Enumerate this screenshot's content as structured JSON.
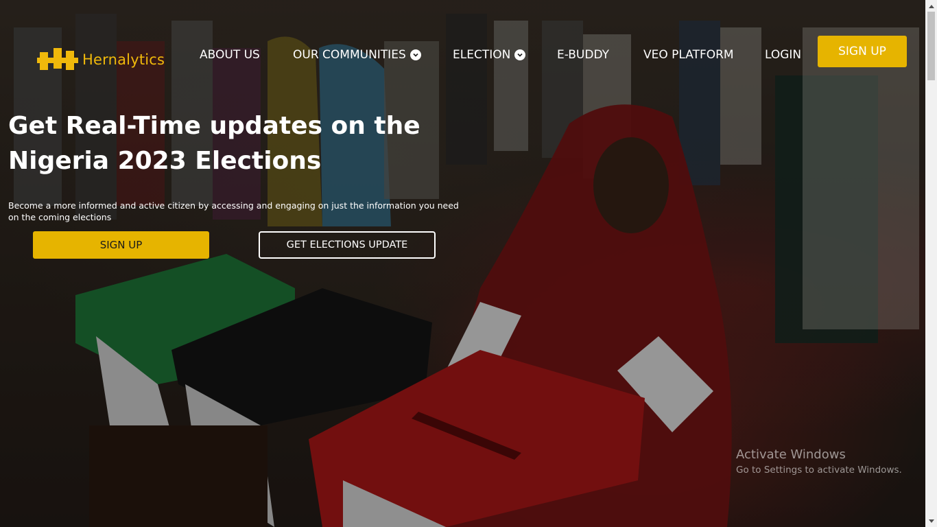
{
  "brand": {
    "name": "Hernalytics",
    "accent": "#e6b400"
  },
  "nav": {
    "items": [
      {
        "label": "ABOUT US",
        "dropdown": false
      },
      {
        "label": "OUR COMMUNITIES",
        "dropdown": true
      },
      {
        "label": "ELECTION",
        "dropdown": true
      },
      {
        "label": "E-BUDDY",
        "dropdown": false
      },
      {
        "label": "VEO PLATFORM",
        "dropdown": false
      },
      {
        "label": "LOGIN",
        "dropdown": false
      }
    ],
    "signup_label": "SIGN UP"
  },
  "hero": {
    "headline": "Get Real-Time updates on the Nigeria 2023 Elections",
    "subtext": "Become a more informed and active citizen by accessing and engaging on just the information you need on the coming elections",
    "signup_label": "SIGN UP",
    "update_label": "GET ELECTIONS UPDATE",
    "image_icon": "ballot-box-voting-photo"
  },
  "watermark": {
    "title": "Activate Windows",
    "subtitle": "Go to Settings to activate Windows."
  }
}
